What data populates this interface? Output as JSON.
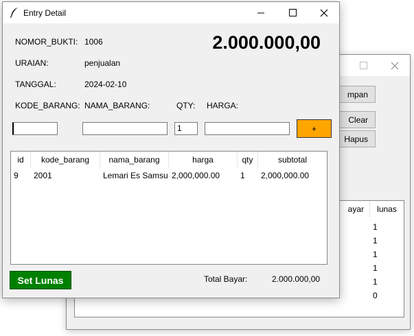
{
  "back_window": {
    "buttons": [
      "mpan",
      "Clear",
      "Hapus"
    ],
    "columns": [
      "ayar",
      "lunas"
    ],
    "lunas_values": [
      "1",
      "1",
      "1",
      "1",
      "1",
      "0"
    ]
  },
  "entry_window": {
    "title": "Entry Detail",
    "fields": {
      "nomor_bukti_label": "NOMOR_BUKTI:",
      "nomor_bukti_value": "1006",
      "uraian_label": "URAIAN:",
      "uraian_value": "penjualan",
      "tanggal_label": "TANGGAL:",
      "tanggal_value": "2024-02-10",
      "total_display": "2.000.000,00"
    },
    "input_labels": {
      "kode_barang": "KODE_BARANG:",
      "nama_barang": "NAMA_BARANG:",
      "qty": "QTY:",
      "harga": "HARGA:"
    },
    "inputs": {
      "kode_barang": "",
      "nama_barang": "",
      "qty": "1",
      "harga": ""
    },
    "add_button": "+",
    "table": {
      "columns": [
        "id",
        "kode_barang",
        "nama_barang",
        "harga",
        "qty",
        "subtotal"
      ],
      "rows": [
        [
          "9",
          "2001",
          "Lemari Es Samsung",
          "2,000,000.00",
          "1",
          "2,000,000.00"
        ]
      ]
    },
    "set_lunas_button": "Set Lunas",
    "total_bayar_label": "Total Bayar:",
    "total_bayar_value": "2.000.000,00"
  },
  "colors": {
    "add_button": "#ffa500",
    "set_lunas_button": "#008000",
    "window_bg": "#f0f0f0"
  }
}
